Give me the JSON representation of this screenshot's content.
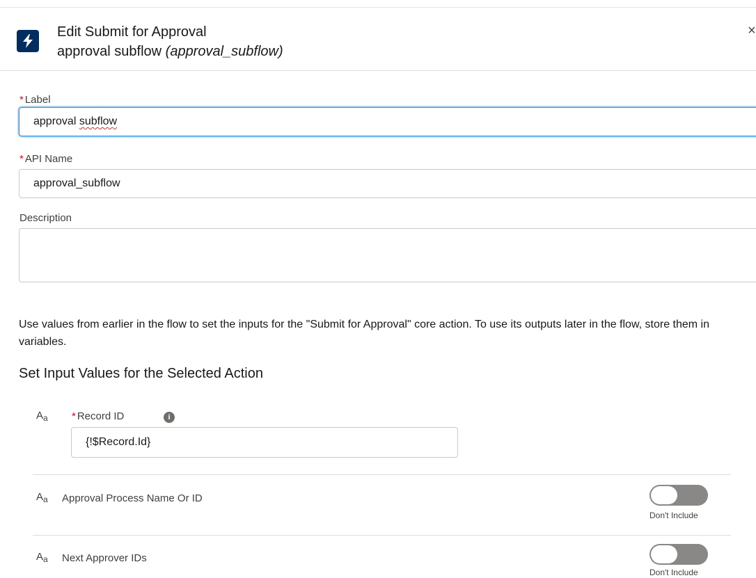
{
  "header": {
    "title": "Edit Submit for Approval",
    "subtitle_label": "approval subflow",
    "subtitle_api": "(approval_subflow)",
    "icon": "lightning-bolt-icon",
    "close_icon": "close-icon",
    "close_glyph": "×"
  },
  "form": {
    "label_field": {
      "required_mark": "*",
      "label": "Label",
      "value_word1": "approval",
      "value_word2": "subflow"
    },
    "api_field": {
      "required_mark": "*",
      "label": "API Name",
      "value": "approval_subflow"
    },
    "description_field": {
      "label": "Description",
      "value": ""
    }
  },
  "help_text": "Use values from earlier in the flow to set the inputs for the \"Submit for Approval\" core action. To use its outputs later in the flow, store them in variables.",
  "section_title": "Set Input Values for the Selected Action",
  "inputs": [
    {
      "type_icon_main": "A",
      "type_icon_sub": "a",
      "required_mark": "*",
      "label": "Record ID",
      "info_icon": "info-icon",
      "value": "{!$Record.Id}"
    },
    {
      "type_icon_main": "A",
      "type_icon_sub": "a",
      "label": "Approval Process Name Or ID",
      "toggle_caption": "Don't Include",
      "toggle_on": false
    },
    {
      "type_icon_main": "A",
      "type_icon_sub": "a",
      "label": "Next Approver IDs",
      "toggle_caption": "Don't Include",
      "toggle_on": false
    }
  ],
  "colors": {
    "brand_icon_bg": "#032d60",
    "required": "#ea001e",
    "focus_border": "#1b96ff",
    "toggle_off": "#8a8886"
  }
}
